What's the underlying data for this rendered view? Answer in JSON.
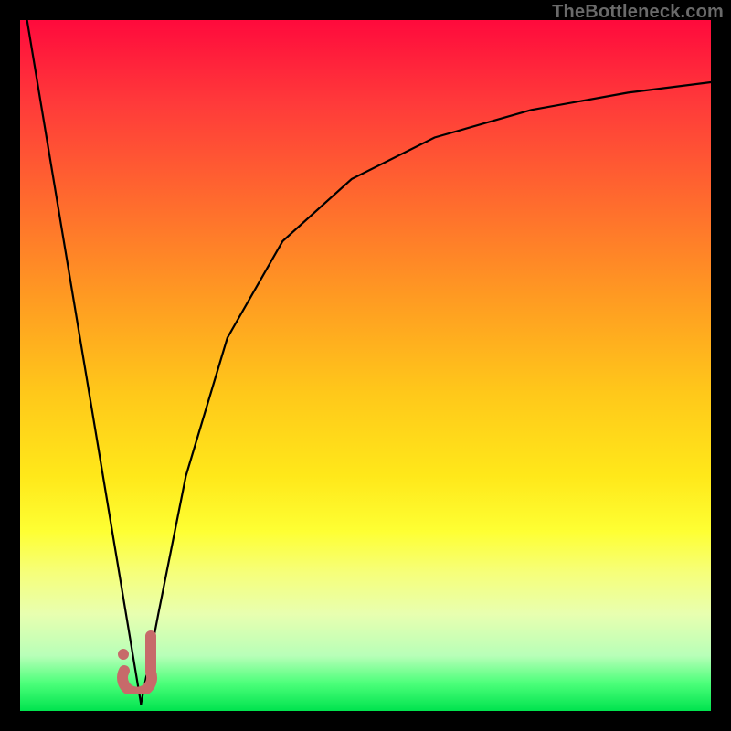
{
  "watermark": "TheBottleneck.com",
  "colors": {
    "frame": "#000000",
    "curve": "#000000",
    "marker": "#c76a6a",
    "gradient_top": "#ff0a3c",
    "gradient_bottom": "#00e34e"
  },
  "chart_data": {
    "type": "line",
    "title": "",
    "xlabel": "",
    "ylabel": "",
    "xlim": [
      0,
      100
    ],
    "ylim": [
      0,
      100
    ],
    "grid": false,
    "legend": false,
    "series": [
      {
        "name": "left-branch",
        "x": [
          1,
          4,
          7,
          10,
          13,
          16,
          17.5
        ],
        "values": [
          100,
          82,
          64,
          46,
          28,
          10,
          1
        ]
      },
      {
        "name": "right-branch",
        "x": [
          17.5,
          20,
          24,
          30,
          38,
          48,
          60,
          74,
          88,
          100
        ],
        "values": [
          1,
          14,
          34,
          54,
          68,
          77,
          83,
          87,
          89.5,
          91
        ]
      }
    ],
    "marker": {
      "shape": "J",
      "color": "#c76a6a",
      "x": 17,
      "y": 4
    }
  }
}
